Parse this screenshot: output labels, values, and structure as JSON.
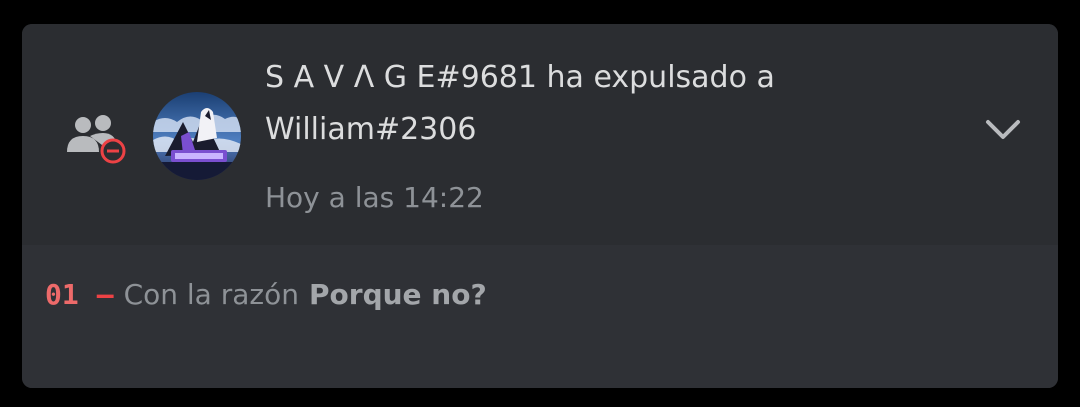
{
  "audit_entry": {
    "message": "S A V Λ G E#9681 ha expulsado a William#2306",
    "timestamp": "Hoy a las 14:22",
    "avatar_icon": "wolf-avatar",
    "action_icon": "member-kick-icon",
    "expand_icon": "chevron-down-icon"
  },
  "changes": [
    {
      "number": "01",
      "dash": "—",
      "label": "Con la razón",
      "value": "Porque no?"
    }
  ],
  "colors": {
    "background": "#000000",
    "card_header": "#2b2d31",
    "card_body": "#2f3136",
    "text_primary": "#dcddde",
    "text_muted": "#8e9297",
    "accent_red": "#ed4245"
  }
}
